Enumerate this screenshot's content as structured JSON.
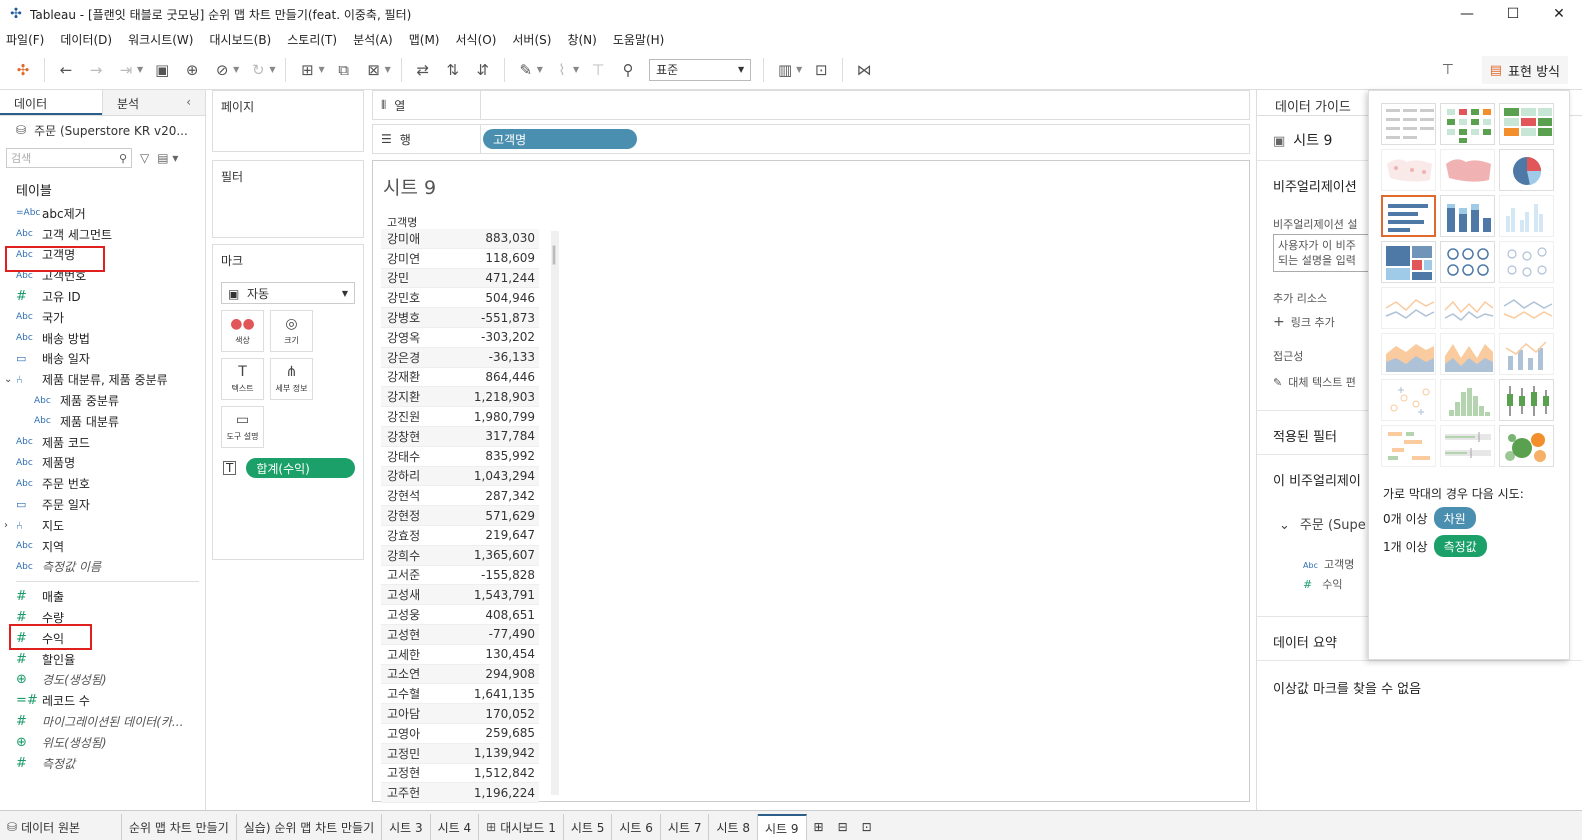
{
  "window": {
    "title": "Tableau - [플랜잇 태블로 굿모닝] 순위 맵 차트 만들기(feat. 이중축, 필터)"
  },
  "menu": [
    "파일(F)",
    "데이터(D)",
    "워크시트(W)",
    "대시보드(B)",
    "스토리(T)",
    "분석(A)",
    "맵(M)",
    "서식(O)",
    "서버(S)",
    "창(N)",
    "도움말(H)"
  ],
  "toolbar": {
    "fit_value": "표준",
    "show_me_label": "표현 방식"
  },
  "data_pane": {
    "tab_data": "데이터",
    "tab_analytics": "분석",
    "datasource": "주문 (Superstore KR v20...",
    "search_placeholder": "검색",
    "tables_title": "테이블",
    "dimensions": [
      {
        "type": "=Abc",
        "name": "abc제거"
      },
      {
        "type": "Abc",
        "name": "고객 세그먼트"
      },
      {
        "type": "Abc",
        "name": "고객명"
      },
      {
        "type": "Abc",
        "name": "고객번호"
      },
      {
        "type": "#",
        "name": "고유 ID"
      },
      {
        "type": "Abc",
        "name": "국가"
      },
      {
        "type": "Abc",
        "name": "배송 방법"
      },
      {
        "type": "date",
        "name": "배송 일자"
      },
      {
        "type": "hier",
        "name": "제품 대분류, 제품 중분류",
        "expand": "⌄"
      },
      {
        "type": "Abc",
        "name": "제품 중분류",
        "sub": true
      },
      {
        "type": "Abc",
        "name": "제품 대분류",
        "sub": true
      },
      {
        "type": "Abc",
        "name": "제품 코드"
      },
      {
        "type": "Abc",
        "name": "제품명"
      },
      {
        "type": "Abc",
        "name": "주문 번호"
      },
      {
        "type": "date",
        "name": "주문 일자"
      },
      {
        "type": "hier",
        "name": "지도",
        "expand": "›"
      },
      {
        "type": "Abc",
        "name": "지역"
      },
      {
        "type": "Abc",
        "name": "측정값 이름",
        "italic": true
      }
    ],
    "measures": [
      {
        "type": "#",
        "name": "매출"
      },
      {
        "type": "#",
        "name": "수량"
      },
      {
        "type": "#",
        "name": "수익"
      },
      {
        "type": "#",
        "name": "할인율"
      },
      {
        "type": "geo",
        "name": "경도(생성됨)",
        "italic": true
      },
      {
        "type": "=#",
        "name": "레코드 수"
      },
      {
        "type": "#",
        "name": "마이그레이션된 데이터(카...",
        "italic": true
      },
      {
        "type": "geo",
        "name": "위도(생성됨)",
        "italic": true
      },
      {
        "type": "#",
        "name": "측정값",
        "italic": true
      }
    ]
  },
  "shelves": {
    "pages": "페이지",
    "filters": "필터",
    "marks": "마크",
    "marks_type": "자동",
    "mark_buttons": [
      {
        "icon": "●●",
        "label": "색상"
      },
      {
        "icon": "◎",
        "label": "크기"
      },
      {
        "icon": "T",
        "label": "텍스트"
      },
      {
        "icon": "⋔",
        "label": "세부 정보"
      },
      {
        "icon": "▭",
        "label": "도구 설명"
      }
    ],
    "marks_pill": "합계(수익)",
    "columns_label": "열",
    "rows_label": "행",
    "rows_pill": "고객명"
  },
  "viz": {
    "title": "시트 9",
    "column_header": "고객명",
    "rows": [
      {
        "name": "강미애",
        "value": "883,030"
      },
      {
        "name": "강미연",
        "value": "118,609"
      },
      {
        "name": "강민",
        "value": "471,244"
      },
      {
        "name": "강민호",
        "value": "504,946"
      },
      {
        "name": "강병호",
        "value": "-551,873"
      },
      {
        "name": "강영옥",
        "value": "-303,202"
      },
      {
        "name": "강은경",
        "value": "-36,133"
      },
      {
        "name": "강재환",
        "value": "864,446"
      },
      {
        "name": "강지환",
        "value": "1,218,903"
      },
      {
        "name": "강진원",
        "value": "1,980,799"
      },
      {
        "name": "강창현",
        "value": "317,784"
      },
      {
        "name": "강태수",
        "value": "835,992"
      },
      {
        "name": "강하리",
        "value": "1,043,294"
      },
      {
        "name": "강현석",
        "value": "287,342"
      },
      {
        "name": "강현정",
        "value": "571,629"
      },
      {
        "name": "강효정",
        "value": "219,647"
      },
      {
        "name": "강희수",
        "value": "1,365,607"
      },
      {
        "name": "고서준",
        "value": "-155,828"
      },
      {
        "name": "고성새",
        "value": "1,543,791"
      },
      {
        "name": "고성웅",
        "value": "408,651"
      },
      {
        "name": "고성현",
        "value": "-77,490"
      },
      {
        "name": "고세한",
        "value": "130,454"
      },
      {
        "name": "고소연",
        "value": "294,908"
      },
      {
        "name": "고수혈",
        "value": "1,641,135"
      },
      {
        "name": "고아담",
        "value": "170,052"
      },
      {
        "name": "고영아",
        "value": "259,685"
      },
      {
        "name": "고정민",
        "value": "1,139,942"
      },
      {
        "name": "고정현",
        "value": "1,512,842"
      },
      {
        "name": "고주헌",
        "value": "1,196,224"
      }
    ]
  },
  "guide": {
    "title": "데이터 가이드",
    "sheet_name": "시트 9",
    "viz_desc_title": "비주얼리제이션",
    "viz_desc_label": "비주얼리제이션 설",
    "desc_placeholder_1": "사용자가 이 비주",
    "desc_placeholder_2": "되는 설명을 입력",
    "resources_title": "추가 리소스",
    "add_link": "링크 추가",
    "accessibility_title": "접근성",
    "alt_text": "대체 텍스트 편",
    "applied_filters": "적용된 필터",
    "this_viz": "이 비주얼리제이",
    "source": "주문 (Supe",
    "field_dim": "고객명",
    "field_measure": "수익",
    "data_summary": "데이터 요약",
    "outliers": "이상값 마크를 찾을 수 없음"
  },
  "show_me": {
    "hint": "가로 막대의 경우 다음 시도:",
    "req_dims_label": "0개 이상",
    "req_dims_pill": "차원",
    "req_measures_label": "1개 이상",
    "req_measures_pill": "측정값",
    "colors": {
      "blue": "#4e79a7",
      "orange": "#f28e2b",
      "green": "#59a14f",
      "red": "#e15759",
      "teal": "#76b7b2"
    }
  },
  "bottom_tabs": [
    {
      "label": "데이터 원본",
      "icon": "db"
    },
    {
      "label": "순위 맵 차트 만들기"
    },
    {
      "label": "실습) 순위 맵 차트 만들기"
    },
    {
      "label": "시트 3"
    },
    {
      "label": "시트 4"
    },
    {
      "label": "대시보드 1",
      "icon": "dash"
    },
    {
      "label": "시트 5"
    },
    {
      "label": "시트 6"
    },
    {
      "label": "시트 7"
    },
    {
      "label": "시트 8"
    },
    {
      "label": "시트 9",
      "active": true
    }
  ]
}
